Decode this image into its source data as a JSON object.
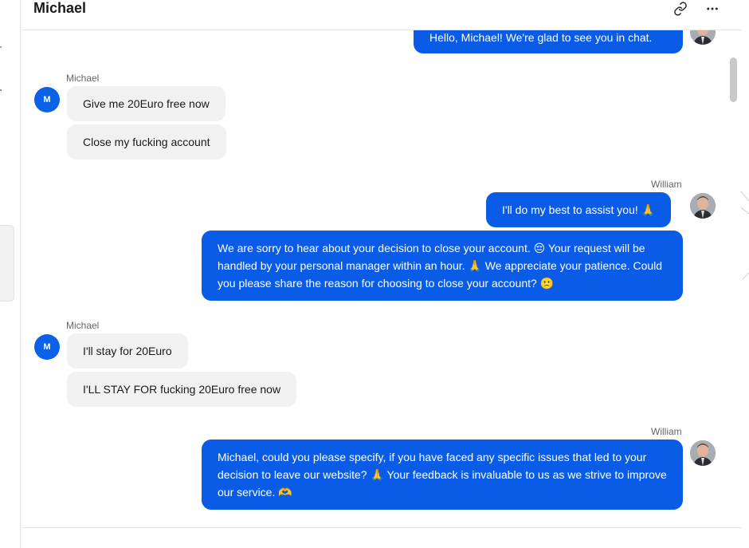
{
  "header": {
    "title": "Michael",
    "icons": [
      "link-icon",
      "more-icon"
    ]
  },
  "messages": {
    "m0": {
      "text": "Hello, Michael! We're glad to see you in chat."
    },
    "g1": {
      "sender": "Michael",
      "avatar": "M",
      "b1": "Give me 20Euro free now",
      "b2": "Close my fucking account"
    },
    "g2": {
      "sender": "William",
      "b1": "I'll do my best to assist you! 🙏",
      "b2": "We are sorry to hear about your decision to close your account. 😔 Your request will be handled by your personal manager within an hour. 🙏 We appreciate your patience. Could you please share the reason for choosing to close your account? 🙁"
    },
    "g3": {
      "sender": "Michael",
      "avatar": "M",
      "b1": "I'll stay for 20Euro",
      "b2": "I'LL STAY FOR fucking 20Euro free now"
    },
    "g4": {
      "sender": "William",
      "b1": "Michael, could you please specify, if you have faced any specific issues that led to your decision to leave our website? 🙏 Your feedback is invaluable to us as we strive to improve our service. 🫶"
    }
  },
  "colors": {
    "outgoing": "#0a5ce6",
    "incoming": "#f1f1f1",
    "avatar": "#0a62e8"
  }
}
